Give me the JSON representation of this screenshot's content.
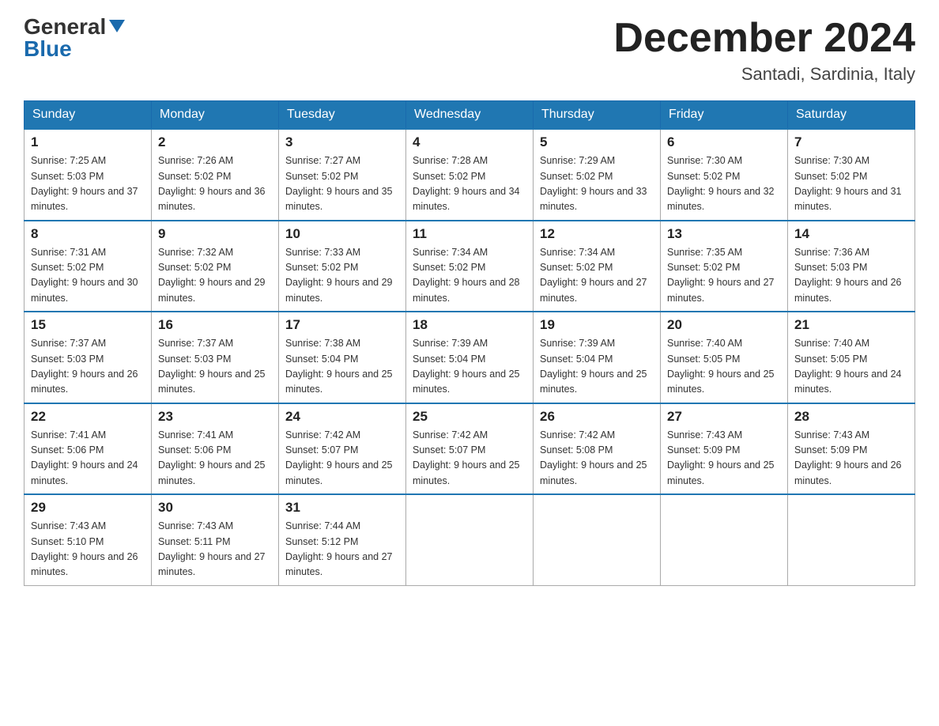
{
  "logo": {
    "general": "General",
    "blue": "Blue"
  },
  "title": {
    "month_year": "December 2024",
    "location": "Santadi, Sardinia, Italy"
  },
  "headers": [
    "Sunday",
    "Monday",
    "Tuesday",
    "Wednesday",
    "Thursday",
    "Friday",
    "Saturday"
  ],
  "weeks": [
    [
      {
        "day": "1",
        "sunrise": "7:25 AM",
        "sunset": "5:03 PM",
        "daylight": "9 hours and 37 minutes."
      },
      {
        "day": "2",
        "sunrise": "7:26 AM",
        "sunset": "5:02 PM",
        "daylight": "9 hours and 36 minutes."
      },
      {
        "day": "3",
        "sunrise": "7:27 AM",
        "sunset": "5:02 PM",
        "daylight": "9 hours and 35 minutes."
      },
      {
        "day": "4",
        "sunrise": "7:28 AM",
        "sunset": "5:02 PM",
        "daylight": "9 hours and 34 minutes."
      },
      {
        "day": "5",
        "sunrise": "7:29 AM",
        "sunset": "5:02 PM",
        "daylight": "9 hours and 33 minutes."
      },
      {
        "day": "6",
        "sunrise": "7:30 AM",
        "sunset": "5:02 PM",
        "daylight": "9 hours and 32 minutes."
      },
      {
        "day": "7",
        "sunrise": "7:30 AM",
        "sunset": "5:02 PM",
        "daylight": "9 hours and 31 minutes."
      }
    ],
    [
      {
        "day": "8",
        "sunrise": "7:31 AM",
        "sunset": "5:02 PM",
        "daylight": "9 hours and 30 minutes."
      },
      {
        "day": "9",
        "sunrise": "7:32 AM",
        "sunset": "5:02 PM",
        "daylight": "9 hours and 29 minutes."
      },
      {
        "day": "10",
        "sunrise": "7:33 AM",
        "sunset": "5:02 PM",
        "daylight": "9 hours and 29 minutes."
      },
      {
        "day": "11",
        "sunrise": "7:34 AM",
        "sunset": "5:02 PM",
        "daylight": "9 hours and 28 minutes."
      },
      {
        "day": "12",
        "sunrise": "7:34 AM",
        "sunset": "5:02 PM",
        "daylight": "9 hours and 27 minutes."
      },
      {
        "day": "13",
        "sunrise": "7:35 AM",
        "sunset": "5:02 PM",
        "daylight": "9 hours and 27 minutes."
      },
      {
        "day": "14",
        "sunrise": "7:36 AM",
        "sunset": "5:03 PM",
        "daylight": "9 hours and 26 minutes."
      }
    ],
    [
      {
        "day": "15",
        "sunrise": "7:37 AM",
        "sunset": "5:03 PM",
        "daylight": "9 hours and 26 minutes."
      },
      {
        "day": "16",
        "sunrise": "7:37 AM",
        "sunset": "5:03 PM",
        "daylight": "9 hours and 25 minutes."
      },
      {
        "day": "17",
        "sunrise": "7:38 AM",
        "sunset": "5:04 PM",
        "daylight": "9 hours and 25 minutes."
      },
      {
        "day": "18",
        "sunrise": "7:39 AM",
        "sunset": "5:04 PM",
        "daylight": "9 hours and 25 minutes."
      },
      {
        "day": "19",
        "sunrise": "7:39 AM",
        "sunset": "5:04 PM",
        "daylight": "9 hours and 25 minutes."
      },
      {
        "day": "20",
        "sunrise": "7:40 AM",
        "sunset": "5:05 PM",
        "daylight": "9 hours and 25 minutes."
      },
      {
        "day": "21",
        "sunrise": "7:40 AM",
        "sunset": "5:05 PM",
        "daylight": "9 hours and 24 minutes."
      }
    ],
    [
      {
        "day": "22",
        "sunrise": "7:41 AM",
        "sunset": "5:06 PM",
        "daylight": "9 hours and 24 minutes."
      },
      {
        "day": "23",
        "sunrise": "7:41 AM",
        "sunset": "5:06 PM",
        "daylight": "9 hours and 25 minutes."
      },
      {
        "day": "24",
        "sunrise": "7:42 AM",
        "sunset": "5:07 PM",
        "daylight": "9 hours and 25 minutes."
      },
      {
        "day": "25",
        "sunrise": "7:42 AM",
        "sunset": "5:07 PM",
        "daylight": "9 hours and 25 minutes."
      },
      {
        "day": "26",
        "sunrise": "7:42 AM",
        "sunset": "5:08 PM",
        "daylight": "9 hours and 25 minutes."
      },
      {
        "day": "27",
        "sunrise": "7:43 AM",
        "sunset": "5:09 PM",
        "daylight": "9 hours and 25 minutes."
      },
      {
        "day": "28",
        "sunrise": "7:43 AM",
        "sunset": "5:09 PM",
        "daylight": "9 hours and 26 minutes."
      }
    ],
    [
      {
        "day": "29",
        "sunrise": "7:43 AM",
        "sunset": "5:10 PM",
        "daylight": "9 hours and 26 minutes."
      },
      {
        "day": "30",
        "sunrise": "7:43 AM",
        "sunset": "5:11 PM",
        "daylight": "9 hours and 27 minutes."
      },
      {
        "day": "31",
        "sunrise": "7:44 AM",
        "sunset": "5:12 PM",
        "daylight": "9 hours and 27 minutes."
      },
      null,
      null,
      null,
      null
    ]
  ]
}
